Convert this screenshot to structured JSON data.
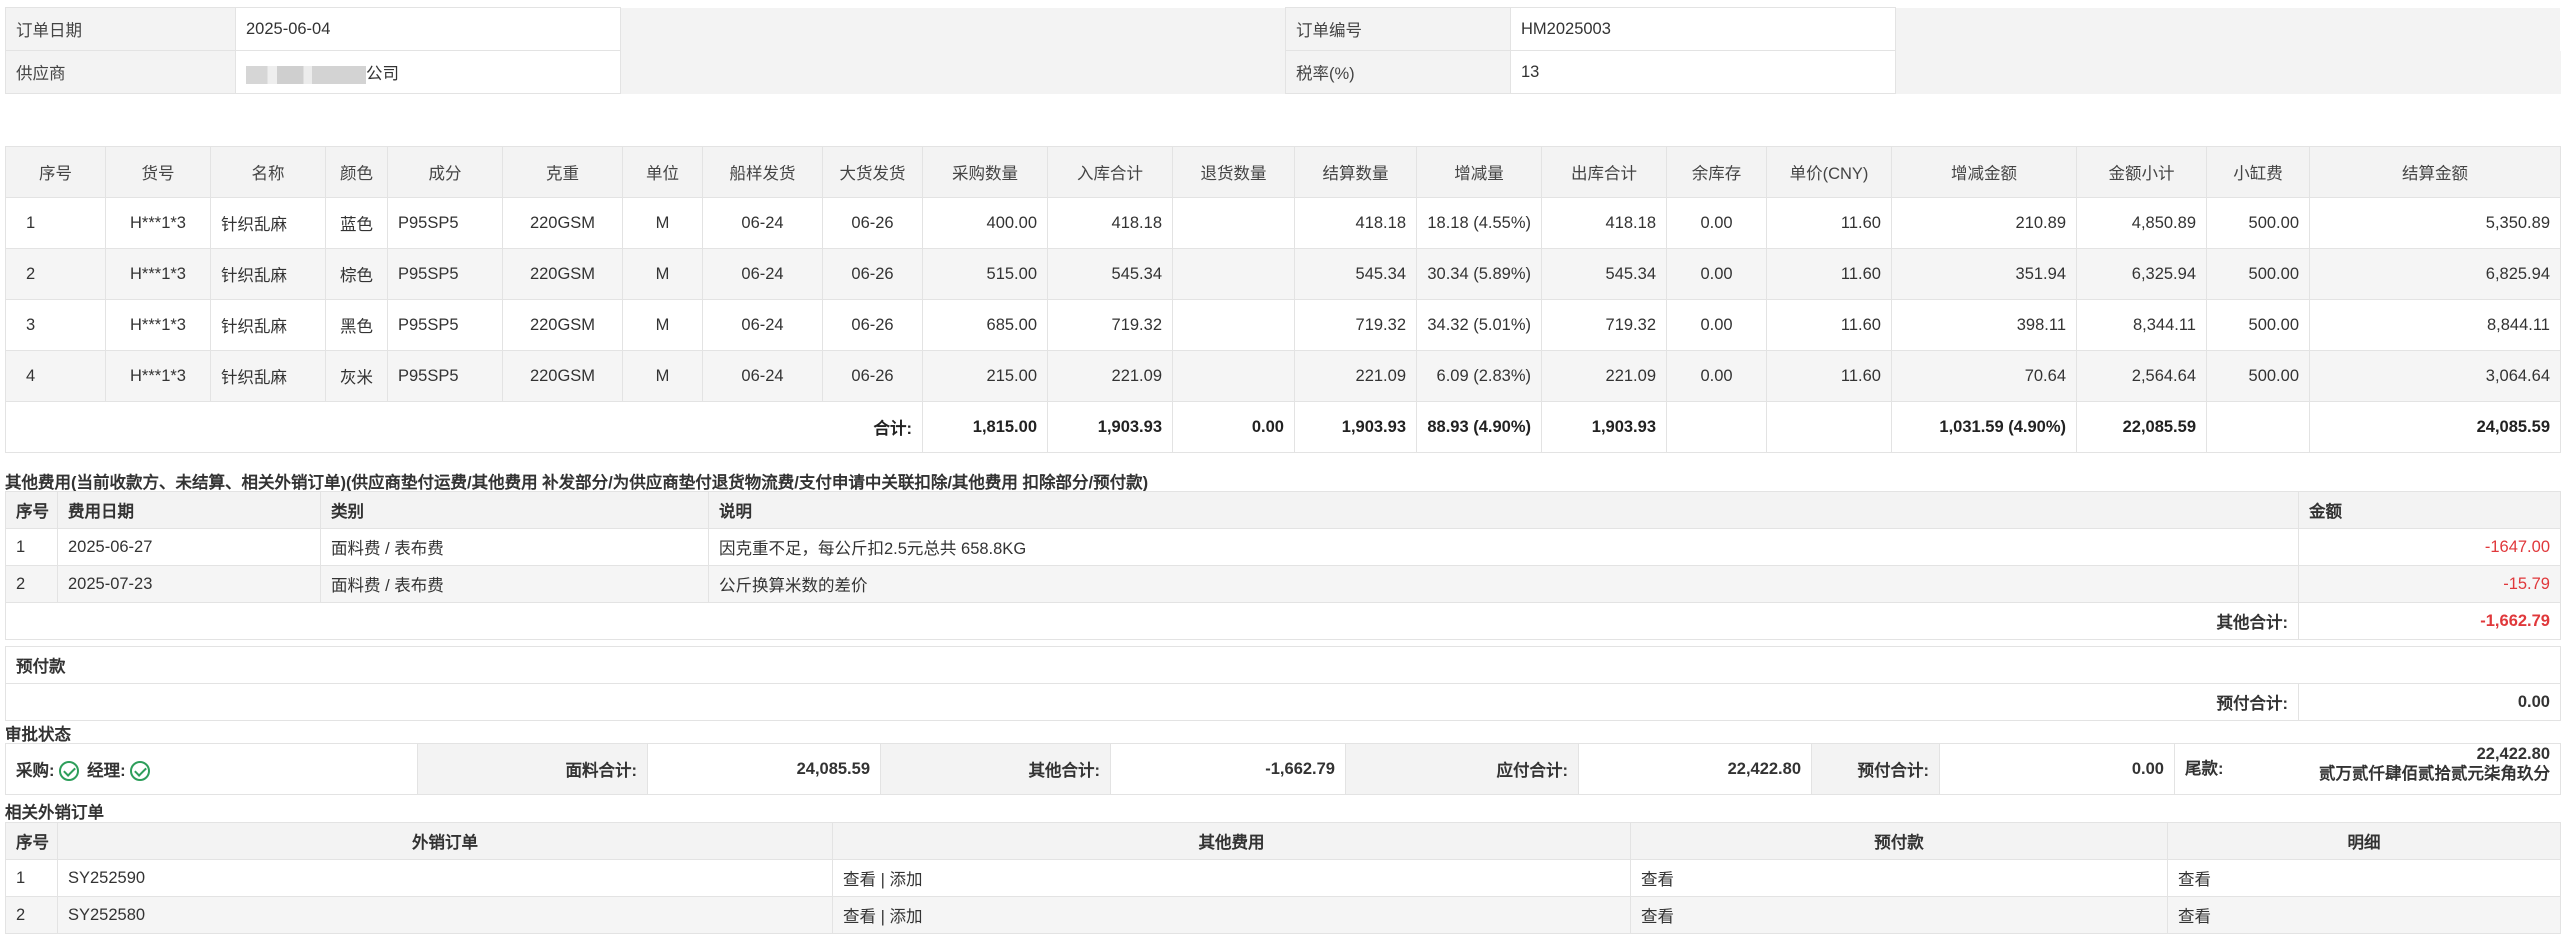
{
  "header": {
    "order_date_label": "订单日期",
    "order_date": "2025-06-04",
    "order_no_label": "订单编号",
    "order_no": "HM2025003",
    "supplier_label": "供应商",
    "supplier_suffix": "公司",
    "tax_label": "税率(%)",
    "tax_value": "13"
  },
  "main_table": {
    "columns": [
      "序号",
      "货号",
      "名称",
      "颜色",
      "成分",
      "克重",
      "单位",
      "船样发货",
      "大货发货",
      "采购数量",
      "入库合计",
      "退货数量",
      "结算数量",
      "增减量",
      "出库合计",
      "余库存",
      "单价(CNY)",
      "增减金额",
      "金额小计",
      "小缸费",
      "结算金额"
    ],
    "rows": [
      [
        "1",
        "H***1*3",
        "针织乱麻",
        "蓝色",
        "P95SP5",
        "220GSM",
        "M",
        "06-24",
        "06-26",
        "400.00",
        "418.18",
        "",
        "418.18",
        "18.18 (4.55%)",
        "418.18",
        "0.00",
        "11.60",
        "210.89",
        "4,850.89",
        "500.00",
        "5,350.89"
      ],
      [
        "2",
        "H***1*3",
        "针织乱麻",
        "棕色",
        "P95SP5",
        "220GSM",
        "M",
        "06-24",
        "06-26",
        "515.00",
        "545.34",
        "",
        "545.34",
        "30.34 (5.89%)",
        "545.34",
        "0.00",
        "11.60",
        "351.94",
        "6,325.94",
        "500.00",
        "6,825.94"
      ],
      [
        "3",
        "H***1*3",
        "针织乱麻",
        "黑色",
        "P95SP5",
        "220GSM",
        "M",
        "06-24",
        "06-26",
        "685.00",
        "719.32",
        "",
        "719.32",
        "34.32 (5.01%)",
        "719.32",
        "0.00",
        "11.60",
        "398.11",
        "8,344.11",
        "500.00",
        "8,844.11"
      ],
      [
        "4",
        "H***1*3",
        "针织乱麻",
        "灰米",
        "P95SP5",
        "220GSM",
        "M",
        "06-24",
        "06-26",
        "215.00",
        "221.09",
        "",
        "221.09",
        "6.09 (2.83%)",
        "221.09",
        "0.00",
        "11.60",
        "70.64",
        "2,564.64",
        "500.00",
        "3,064.64"
      ]
    ],
    "total": {
      "label": "合计:",
      "purchase_qty": "1,815.00",
      "in_total": "1,903.93",
      "return_qty": "0.00",
      "settle_qty": "1,903.93",
      "delta_qty": "88.93 (4.90%)",
      "out_total": "1,903.93",
      "delta_amount": "1,031.59 (4.90%)",
      "subtotal": "22,085.59",
      "settle_amount": "24,085.59"
    }
  },
  "other_fees": {
    "title": "其他费用(当前收款方、未结算、相关外销订单)(供应商垫付运费/其他费用 补发部分/为供应商垫付退货物流费/支付申请中关联扣除/其他费用 扣除部分/预付款)",
    "columns": [
      "序号",
      "费用日期",
      "类别",
      "说明",
      "金额"
    ],
    "rows": [
      {
        "no": "1",
        "date": "2025-06-27",
        "category": "面料费 / 表布费",
        "desc": "因克重不足，每公斤扣2.5元总共 658.8KG",
        "amount": "-1647.00"
      },
      {
        "no": "2",
        "date": "2025-07-23",
        "category": "面料费 / 表布费",
        "desc": "公斤换算米数的差价",
        "amount": "-15.79"
      }
    ],
    "total_label": "其他合计:",
    "total_value": "-1,662.79"
  },
  "prepay": {
    "title": "预付款",
    "total_label": "预付合计:",
    "total_value": "0.00"
  },
  "approval": {
    "title": "审批状态",
    "purchase_label": "采购:",
    "manager_label": "经理:",
    "fabric_total_label": "面料合计:",
    "fabric_total": "24,085.59",
    "other_total_label": "其他合计:",
    "other_total": "-1,662.79",
    "payable_label": "应付合计:",
    "payable": "22,422.80",
    "prepay_label": "预付合计:",
    "prepay": "0.00",
    "balance_label": "尾款:",
    "balance": "22,422.80",
    "balance_words": "贰万贰仟肆佰贰拾贰元柒角玖分"
  },
  "related": {
    "title": "相关外销订单",
    "columns": [
      "序号",
      "外销订单",
      "其他费用",
      "预付款",
      "明细"
    ],
    "rows": [
      {
        "no": "1",
        "order": "SY252590",
        "view": "查看",
        "sep": " | ",
        "add": "添加",
        "prepay_view": "查看",
        "detail_view": "查看"
      },
      {
        "no": "2",
        "order": "SY252580",
        "view": "查看",
        "sep": " | ",
        "add": "添加",
        "prepay_view": "查看",
        "detail_view": "查看"
      }
    ]
  }
}
